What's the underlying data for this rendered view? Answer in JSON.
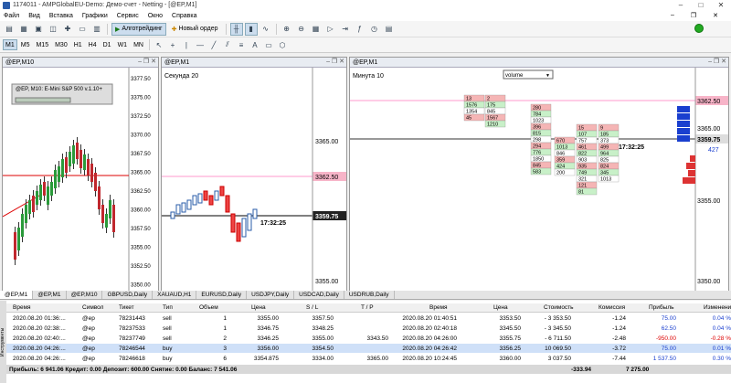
{
  "window": {
    "title": "1174011 - AMPGlobalEU-Demo: Демо-счет - Netting - [@EP,M1]"
  },
  "menu": [
    "Файл",
    "Вид",
    "Вставка",
    "Графики",
    "Сервис",
    "Окно",
    "Справка"
  ],
  "toolbar": {
    "algo": "Алготрейдинг",
    "neworder": "Новый ордер"
  },
  "timeframes": [
    "M1",
    "M5",
    "M15",
    "M30",
    "H1",
    "H4",
    "D1",
    "W1",
    "MN"
  ],
  "active_tf": "M1",
  "panels": {
    "p1": {
      "title": "@EP,M10",
      "label": "@EP, M10: E-Mini S&P 500 v.1.10+"
    },
    "p2": {
      "title": "@EP,M1",
      "label": "Секунда 20",
      "price_hi": "3362.50",
      "price_cur": "3359.75",
      "time": "17:32:25",
      "ticks": [
        "3365.00",
        "3360.00",
        "3355.00"
      ]
    },
    "p3": {
      "title": "@EP,M1",
      "label": "Минута 10",
      "vol": "volume",
      "price_hi": "3362.50",
      "price_cur": "3359.75",
      "vol427": "427",
      "time": "17:32:25",
      "ticks": [
        "3365.00",
        "3360.00",
        "3355.00",
        "3350.00"
      ]
    }
  },
  "p1ticks": [
    "3377.50",
    "3375.00",
    "3372.50",
    "3370.00",
    "3367.50",
    "3365.00",
    "3362.50",
    "3360.00",
    "3357.50",
    "3355.00",
    "3352.50",
    "3350.00"
  ],
  "tabs": [
    "@EP,M1",
    "@EP,M1",
    "@EP,M10",
    "GBPUSD,Daily",
    "XAUAUD,H1",
    "EURUSD,Daily",
    "USDJPY,Daily",
    "USDCAD,Daily",
    "USDRUB,Daily"
  ],
  "table": {
    "headers": [
      "Время",
      "Символ",
      "Тикет",
      "Тип",
      "Объем",
      "Цена",
      "S / L",
      "T / P",
      "Время",
      "Цена",
      "Стоимость",
      "Комиссия",
      "Прибыль",
      "Изменение"
    ],
    "rows": [
      [
        "2020.08.20 01:36:...",
        "@ep",
        "78231443",
        "sell",
        "1",
        "3355.00",
        "3357.50",
        "",
        "2020.08.20 01:40:51",
        "3353.50",
        "- 3 353.50",
        "-1.24",
        "75.00",
        "0.04 %"
      ],
      [
        "2020.08.20 02:38:...",
        "@ep",
        "78237533",
        "sell",
        "1",
        "3346.75",
        "3348.25",
        "",
        "2020.08.20 02:40:18",
        "3345.50",
        "- 3 345.50",
        "-1.24",
        "62.50",
        "0.04 %"
      ],
      [
        "2020.08.20 02:40:...",
        "@ep",
        "78237749",
        "sell",
        "2",
        "3346.25",
        "3355.00",
        "3343.50",
        "2020.08.20 04:26:00",
        "3355.75",
        "- 6 711.50",
        "-2.48",
        "-950.00",
        "-0.28 %"
      ],
      [
        "2020.08.20 04:26:...",
        "@ep",
        "78246544",
        "buy",
        "3",
        "3356.00",
        "3354.50",
        "",
        "2020.08.20 04:26:42",
        "3356.25",
        "10 069.50",
        "-3.72",
        "75.00",
        "0.01 %"
      ],
      [
        "2020.08.20 04:26:...",
        "@ep",
        "78246618",
        "buy",
        "6",
        "3354.875",
        "3334.00",
        "3365.00",
        "2020.08.20 10:24:45",
        "3360.00",
        "3 037.50",
        "-7.44",
        "1 537.50",
        "0.30 %"
      ]
    ],
    "footer": "Прибыль: 6 941.06  Кредит: 0.00  Депозит: 600.00  Снятие: 0.00  Баланс: 7 541.06",
    "foot_comm": "-333.94",
    "foot_profit": "7 275.00"
  },
  "side_label": "Инструменты"
}
